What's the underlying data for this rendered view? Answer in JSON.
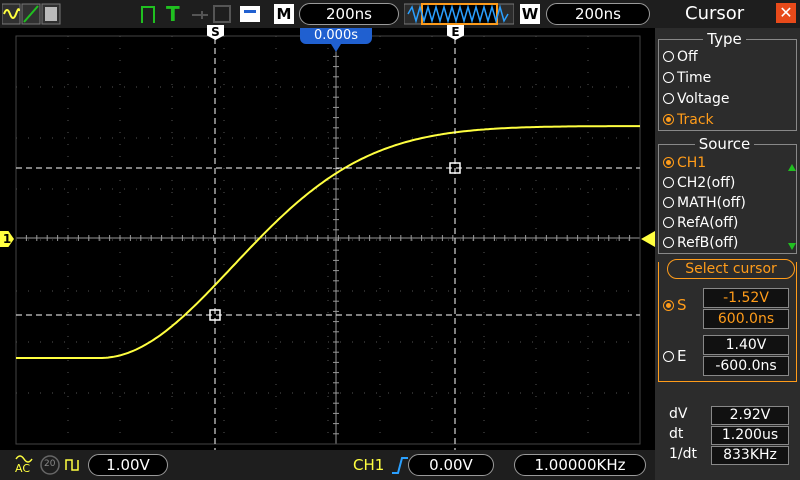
{
  "topbar": {
    "memory_label": "M",
    "timebase": "200ns",
    "window_label": "W",
    "window_timebase": "200ns",
    "trigger_status": "T",
    "offset_marker": "0.000s"
  },
  "cursor_markers": {
    "start": "S",
    "end": "E"
  },
  "channel_marker": "1",
  "bottombar": {
    "coupling": "AC",
    "bw_limit": "20",
    "volts_div": "1.00V",
    "trigger_source": "CH1",
    "trigger_level": "0.00V",
    "frequency": "1.00000KHz"
  },
  "panel": {
    "title": "Cursor",
    "type_group": {
      "title": "Type",
      "options": [
        "Off",
        "Time",
        "Voltage",
        "Track"
      ],
      "selected": "Track"
    },
    "source_group": {
      "title": "Source",
      "options": [
        "CH1",
        "CH2(off)",
        "MATH(off)",
        "RefA(off)",
        "RefB(off)"
      ],
      "selected": "CH1"
    },
    "select_cursor_label": "Select cursor",
    "s_cursor": {
      "label": "S",
      "voltage": "-1.52V",
      "time": "600.0ns"
    },
    "e_cursor": {
      "label": "E",
      "voltage": "1.40V",
      "time": "-600.0ns"
    },
    "measurements": [
      {
        "label": "dV",
        "value": "2.92V"
      },
      {
        "label": "dt",
        "value": "1.200us"
      },
      {
        "label": "1/dt",
        "value": "833KHz"
      }
    ]
  },
  "colors": {
    "trace": "#ffff40",
    "accent": "#ff9c1a",
    "timebase_box": "#2060d0",
    "trigger_green": "#20c020",
    "close": "#e84a1a"
  }
}
